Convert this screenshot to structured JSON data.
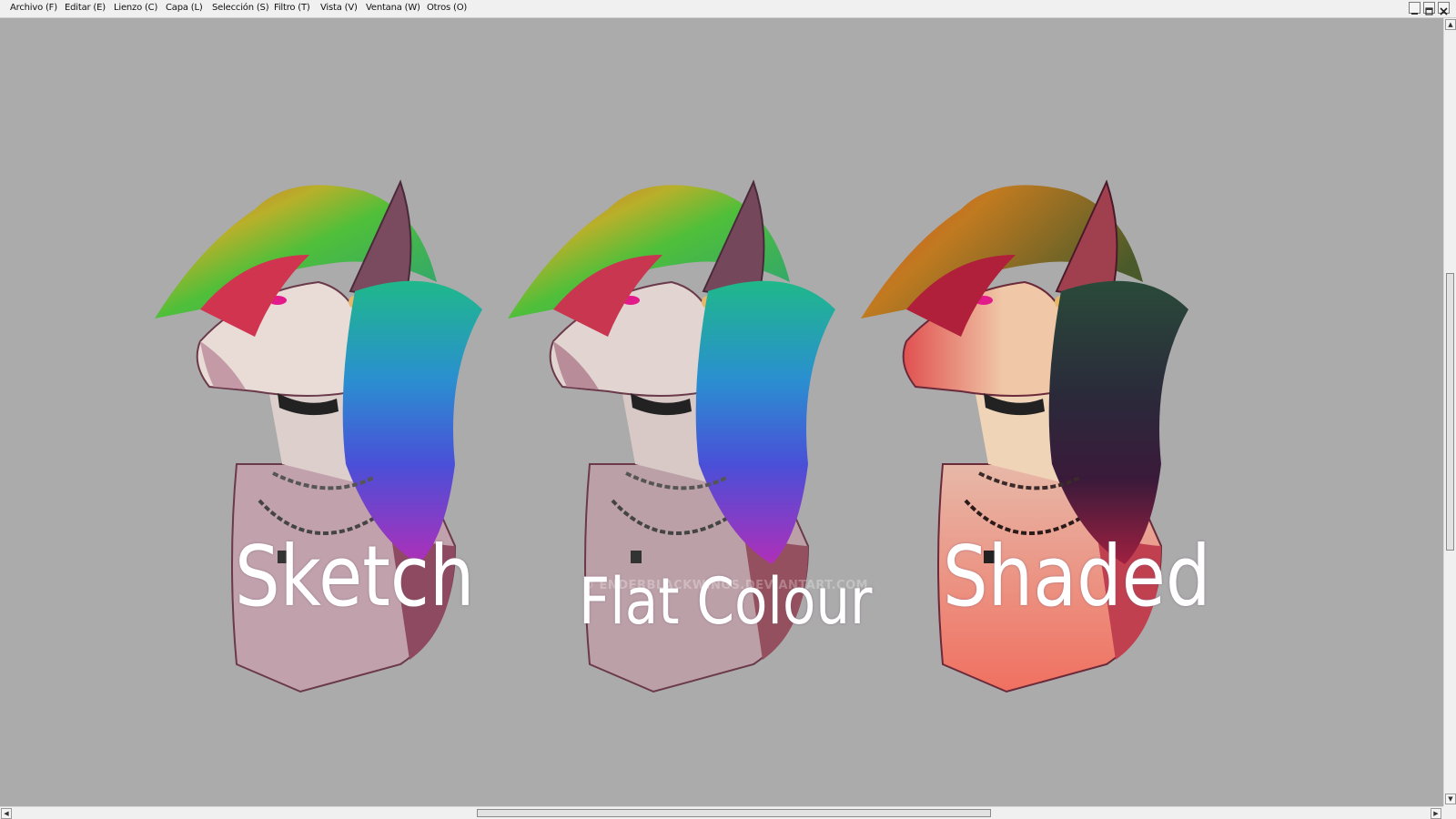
{
  "menu": [
    {
      "id": "archivo",
      "label": "Archivo (F)"
    },
    {
      "id": "editar",
      "label": "Editar (E)"
    },
    {
      "id": "lienzo",
      "label": "Lienzo (C)"
    },
    {
      "id": "capa",
      "label": "Capa (L)"
    },
    {
      "id": "seleccion",
      "label": "Selección (S)"
    },
    {
      "id": "filtro",
      "label": "Filtro (T)"
    },
    {
      "id": "vista",
      "label": "Vista (V)"
    },
    {
      "id": "ventana",
      "label": "Ventana (W)"
    },
    {
      "id": "otros",
      "label": "Otros (O)"
    }
  ],
  "artwork": {
    "labels": {
      "sketch": "Sketch",
      "flat": "Flat Colour",
      "shaded": "Shaded"
    },
    "watermark": "© ENDERBLACKWINGS.DEVIANTART.COM"
  },
  "colors": {
    "canvas": "#ababab",
    "menubar": "#f0f0f0"
  },
  "icons": {
    "minimize": "minimize-icon",
    "restore": "restore-icon",
    "close": "close-icon"
  }
}
